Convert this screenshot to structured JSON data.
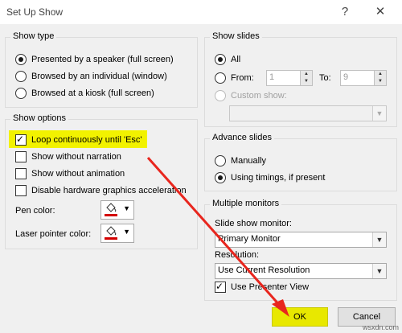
{
  "dialog": {
    "title": "Set Up Show",
    "help_icon": "?",
    "close_icon": "✕"
  },
  "show_type": {
    "heading": "Show type",
    "options": [
      {
        "label": "Presented by a speaker (full screen)",
        "selected": true
      },
      {
        "label": "Browsed by an individual (window)",
        "selected": false
      },
      {
        "label": "Browsed at a kiosk (full screen)",
        "selected": false
      }
    ]
  },
  "show_options": {
    "heading": "Show options",
    "checkboxes": [
      {
        "label": "Loop continuously until 'Esc'",
        "checked": true
      },
      {
        "label": "Show without narration",
        "checked": false
      },
      {
        "label": "Show without animation",
        "checked": false
      },
      {
        "label": "Disable hardware graphics acceleration",
        "checked": false
      }
    ],
    "pen_color_label": "Pen color:",
    "laser_color_label": "Laser pointer color:",
    "color_swatch": "#d40000"
  },
  "show_slides": {
    "heading": "Show slides",
    "all_label": "All",
    "from_label": "From:",
    "from_value": "1",
    "to_label": "To:",
    "to_value": "9",
    "custom_label": "Custom show:"
  },
  "advance_slides": {
    "heading": "Advance slides",
    "manually": "Manually",
    "timings": "Using timings, if present"
  },
  "monitors": {
    "heading": "Multiple monitors",
    "monitor_label": "Slide show monitor:",
    "monitor_value": "Primary Monitor",
    "resolution_label": "Resolution:",
    "resolution_value": "Use Current Resolution",
    "presenter_label": "Use Presenter View"
  },
  "buttons": {
    "ok": "OK",
    "cancel": "Cancel"
  },
  "watermark": "wsxdn.com",
  "accent": {
    "highlight": "#f2f200",
    "arrow": "#e8261e"
  }
}
